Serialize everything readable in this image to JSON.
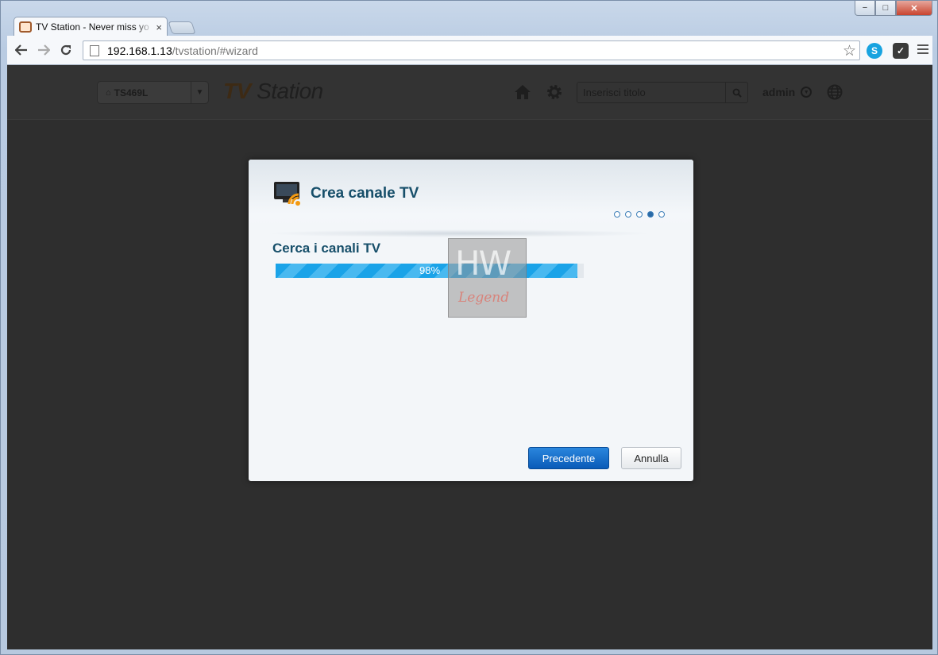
{
  "browser": {
    "tab_title": "TV Station - Never miss yo",
    "tab_close": "×",
    "url_host": "192.168.1.13",
    "url_path": "/tvstation/#wizard",
    "window_controls": {
      "minimize": "−",
      "maximize": "□",
      "close": "✕"
    }
  },
  "app": {
    "device_select": "TS469L",
    "logo_tv": "TV",
    "logo_station": "Station",
    "search_placeholder": "Inserisci titolo",
    "user": "admin"
  },
  "dialog": {
    "title": "Crea canale TV",
    "steps": [
      false,
      false,
      false,
      true,
      false
    ],
    "section_title": "Cerca i canali TV",
    "progress": {
      "value": 98,
      "label": "98%"
    },
    "watermark": {
      "top": "HW",
      "bottom": "Legend"
    },
    "buttons": {
      "previous": "Precedente",
      "cancel": "Annulla"
    }
  },
  "colors": {
    "accent": "#0a5bb8",
    "title": "#174f6a",
    "progress": "#1aa3e8",
    "background": "#2e2e2e"
  }
}
